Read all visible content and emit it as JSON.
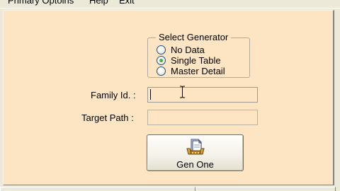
{
  "menubar": {
    "items": [
      {
        "label": "Primary Optoins"
      },
      {
        "label": "Help"
      },
      {
        "label": "Exit"
      }
    ]
  },
  "generator_group": {
    "title": "Select Generator",
    "options": [
      {
        "label": "No Data",
        "checked": false
      },
      {
        "label": "Single Table",
        "checked": true
      },
      {
        "label": "Master Detail",
        "checked": false
      }
    ]
  },
  "form": {
    "family_id": {
      "label": "Family Id.  :",
      "value": ""
    },
    "target_path": {
      "label": "Target Path  :",
      "value": ""
    }
  },
  "gen_button": {
    "label": "Gen One",
    "icon": "generate-document-icon"
  },
  "colors": {
    "panel_background": "#fde5c4",
    "window_chrome": "#ece9d8",
    "radio_selected": "#1f9c1f"
  }
}
